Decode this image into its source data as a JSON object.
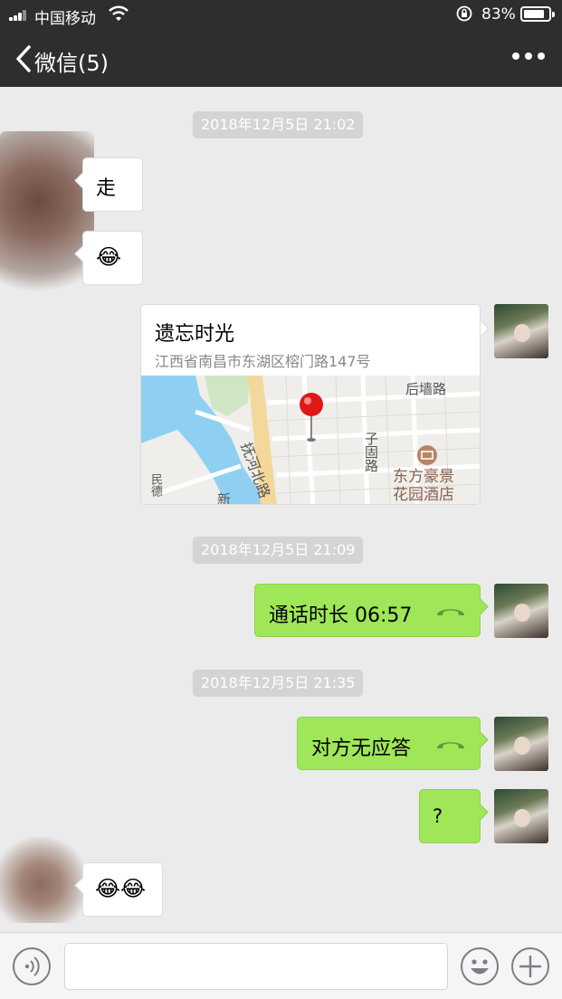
{
  "status_bar": {
    "carrier": "中国移动",
    "battery": "83%",
    "battery_level": 0.83
  },
  "nav": {
    "title": "微信(5)"
  },
  "timestamps": [
    "2018年12月5日 21:02",
    "2018年12月5日 21:09",
    "2018年12月5日 21:35"
  ],
  "messages": {
    "m1": "走",
    "m2": "😂",
    "location": {
      "title": "遗忘时光",
      "address": "江西省南昌市东湖区榕门路147号",
      "map_labels": {
        "road1": "后墙路",
        "road2": "抚河北路",
        "road3": "子固路",
        "hotel": "东方豪景\n花园酒店",
        "road4": "新",
        "road5": "民德"
      }
    },
    "call1": "通话时长 06:57",
    "call2": "对方无应答",
    "q": "?",
    "m_last": "😂😂"
  },
  "colors": {
    "header": "#2e2e30",
    "bubble_out": "#9fe658",
    "bubble_in": "#ffffff",
    "background": "#ebebeb"
  },
  "icons": [
    "signal-icon",
    "wifi-icon",
    "orientation-lock-icon",
    "battery-icon",
    "back-icon",
    "more-icon",
    "phone-icon",
    "voice-icon",
    "emoji-icon",
    "plus-icon",
    "location-pin-icon",
    "hotel-icon"
  ]
}
